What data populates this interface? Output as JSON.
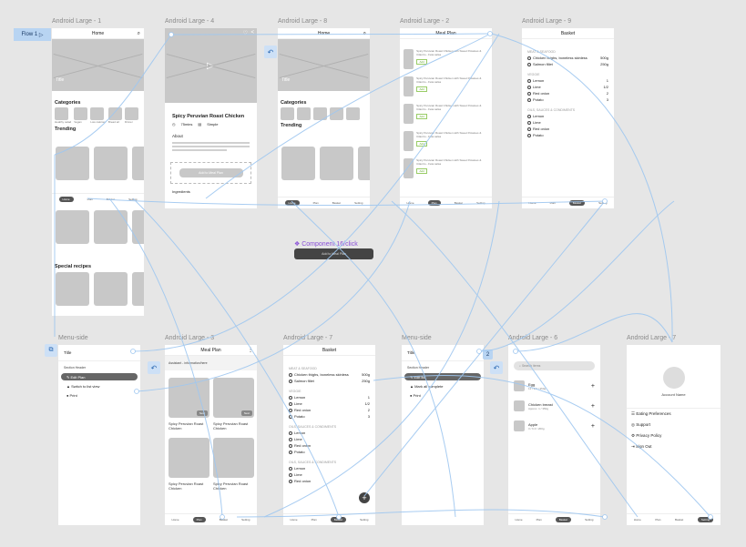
{
  "flow": {
    "label": "Flow 1",
    "badge2": "2"
  },
  "frames": {
    "f1": {
      "name": "Android Large - 1",
      "title": "Home",
      "hero": "Title",
      "hero_sub": "Lorem ipsum dolor sit amet, consectetur adipiscing elit",
      "categories": "Categories",
      "cats": [
        "Healthy salad",
        "Vegan",
        "Low calories",
        "Bread art",
        "Dinner"
      ],
      "trending": "Trending",
      "special": "Special recipes",
      "lorem": "Lorem ipsum dolor sit amet"
    },
    "f4": {
      "name": "Android Large - 4",
      "recipe": "Spicy Peruvian Roast Chicken",
      "time": "75mins",
      "level": "Simple",
      "about": "About",
      "add": "Add to Meal Plan",
      "ingredients": "Ingredients"
    },
    "f8": {
      "name": "Android Large - 8",
      "title": "Home",
      "hero": "Title",
      "categories": "Categories",
      "trending": "Trending"
    },
    "f2": {
      "name": "Android Large - 2",
      "title": "Meal Plan",
      "item": "Spicy Peruvian Roast Chicken with Sweet Potatoes & Cilantro - Feta salsa",
      "btn": "Add"
    },
    "f9": {
      "name": "Android Large - 9",
      "title": "Basket"
    },
    "ms1": {
      "name": "Menu-side",
      "title": "Title",
      "header": "Section Header",
      "items": [
        "Edit Plan",
        "Switch to list view",
        "Print"
      ]
    },
    "f3": {
      "name": "Android Large - 3",
      "title": "Meal Plan",
      "sub": "Assistant - information/here",
      "card": "Spicy Peruvian Roast Chicken",
      "badge": "Next"
    },
    "f7a": {
      "name": "Android Large - 7",
      "title": "Basket"
    },
    "ms2": {
      "name": "Menu-side",
      "title": "Title",
      "header": "Section Header",
      "items": [
        "Edit list",
        "Mark all complete",
        "Print"
      ]
    },
    "f6": {
      "name": "Android Large - 6",
      "search": "Search items",
      "items": [
        {
          "n": "Egg",
          "s": "12 / 2.0 / 350g"
        },
        {
          "n": "Chicken breast",
          "s": "Approx. 1 / 350g"
        },
        {
          "n": "Apple",
          "s": "3 / 6.3 / 200g"
        }
      ]
    },
    "f7b": {
      "name": "Android Large - 7",
      "account": "Account Name",
      "menu": [
        "Eating Preferences",
        "Support",
        "Privacy Policy",
        "Sign Out"
      ]
    }
  },
  "basket": {
    "sec1": "MEAT & SEAFOOD",
    "meat": [
      {
        "n": "Chicken thighs, boneless skinless",
        "q": "500g"
      },
      {
        "n": "Salmon fillet",
        "q": "250g"
      }
    ],
    "sec2": "VEGGIE",
    "veg": [
      {
        "n": "Lemon",
        "q": "1"
      },
      {
        "n": "Lime",
        "q": "1/2"
      },
      {
        "n": "Red onion",
        "q": "2"
      },
      {
        "n": "Potato",
        "q": "3"
      }
    ],
    "sec3": "OILS, SAUCES & CONDIMENTS",
    "oils": [
      "Lemon",
      "Lime",
      "Red onion",
      "Potato"
    ],
    "sec4": "OILS, SAUCES & CONDIMENTS",
    "oils2": [
      "Lemon",
      "Lime",
      "Red onion"
    ]
  },
  "nav": [
    "Home",
    "Plan",
    "Basket",
    "Setting"
  ],
  "component": {
    "label": "Component 16/click",
    "button": "Add to Meal Plan"
  }
}
